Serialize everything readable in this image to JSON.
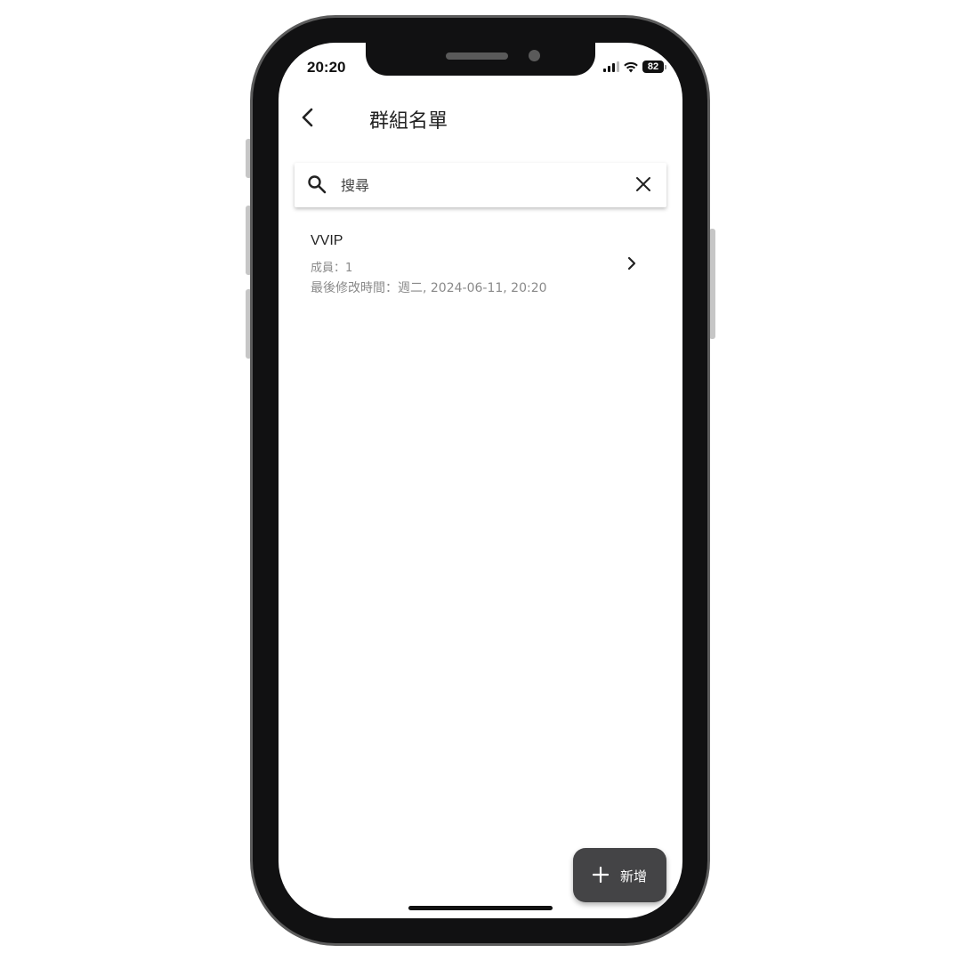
{
  "status_bar": {
    "time": "20:20",
    "battery": "82",
    "icons": [
      "signal-icon",
      "wifi-icon",
      "battery-icon"
    ]
  },
  "app_bar": {
    "back_icon": "chevron-left-icon",
    "title": "群組名單"
  },
  "search": {
    "placeholder": "搜尋",
    "value": "",
    "icon": "search-icon",
    "clear_icon": "close-icon"
  },
  "groups": [
    {
      "name": "VVIP",
      "members": "成員：1",
      "last_modified": "最後修改時間：週二, 2024-06-11, 20:20",
      "chevron_icon": "chevron-right-icon"
    }
  ],
  "fab": {
    "icon": "plus-icon",
    "label": "新增",
    "color": "#444446"
  }
}
